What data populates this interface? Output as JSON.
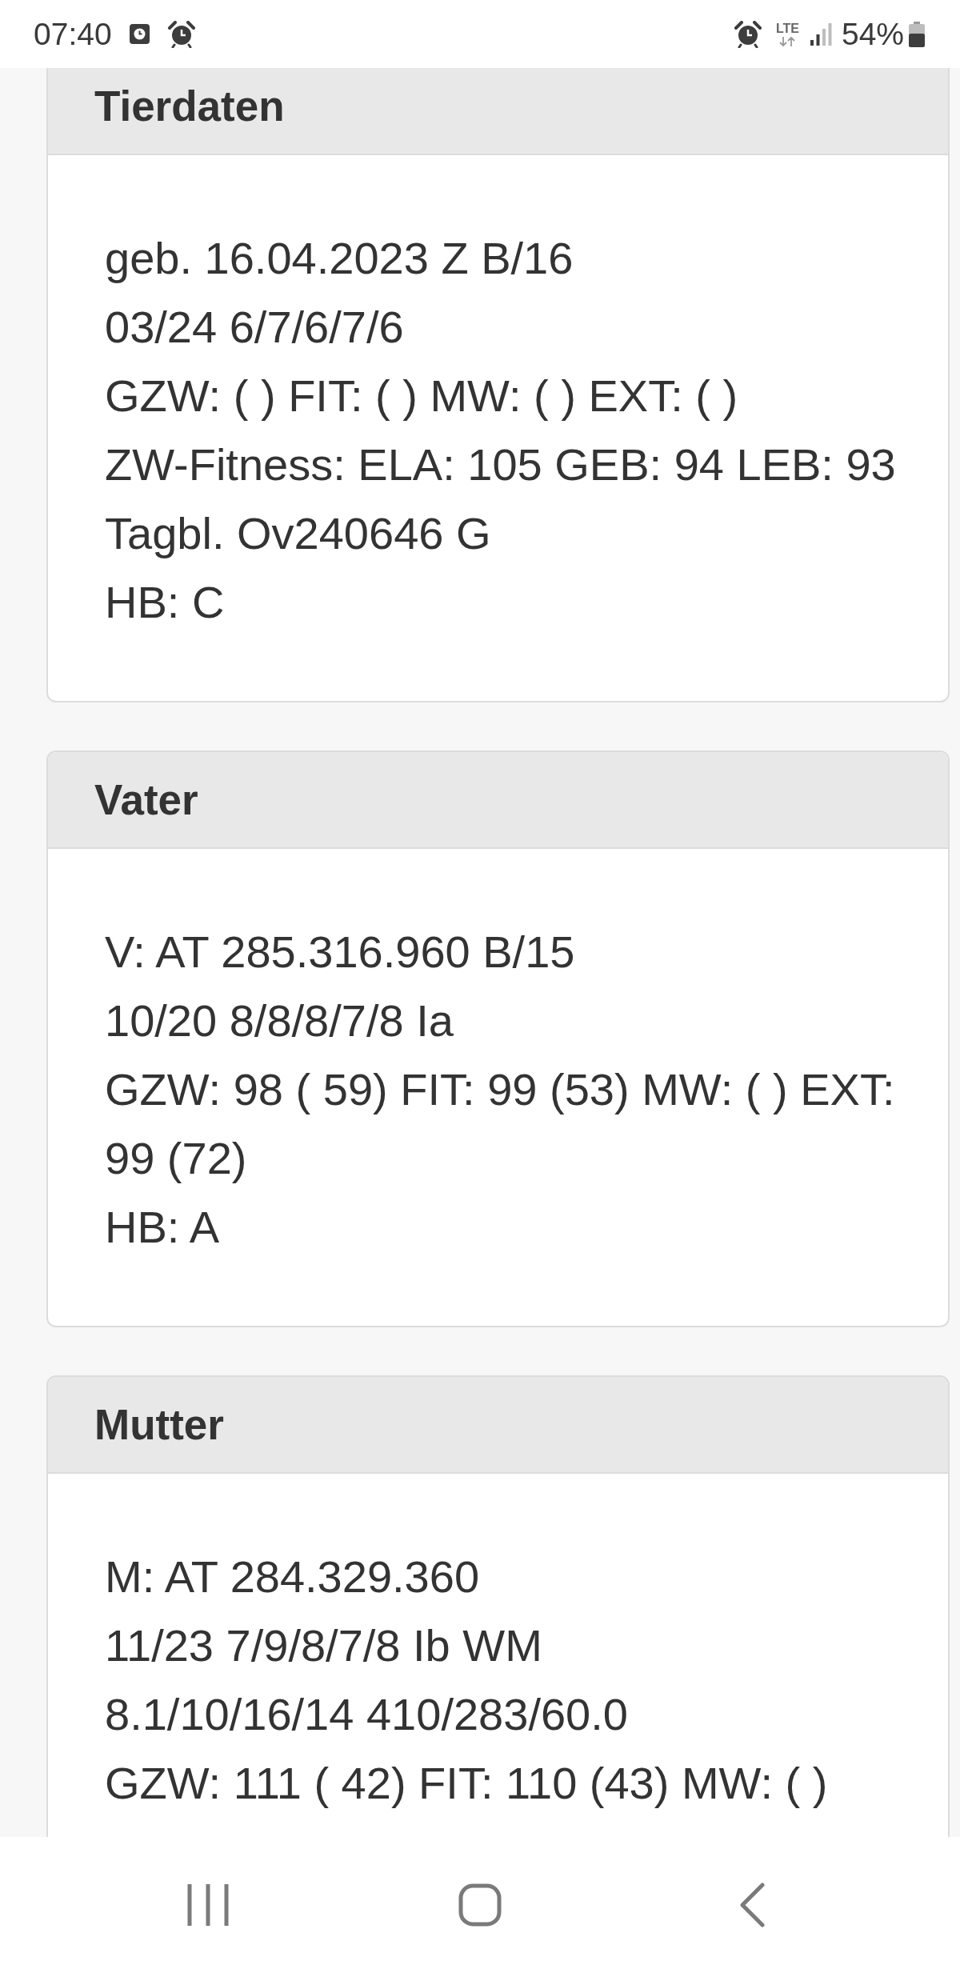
{
  "status_bar": {
    "time": "07:40",
    "network": "LTE",
    "battery": "54%"
  },
  "cards": [
    {
      "title": "Tierdaten",
      "lines": [
        "geb. 16.04.2023 Z B/16",
        "03/24 6/7/6/7/6",
        "GZW: ( ) FIT: ( ) MW: ( ) EXT: ( )",
        "ZW-Fitness: ELA: 105 GEB: 94 LEB: 93",
        "Tagbl. Ov240646 G",
        "HB: C"
      ]
    },
    {
      "title": "Vater",
      "lines": [
        "V: AT 285.316.960 B/15",
        "10/20 8/8/8/7/8 Ia",
        "GZW: 98 ( 59) FIT: 99 (53) MW: ( ) EXT: 99 (72)",
        "HB: A"
      ]
    },
    {
      "title": "Mutter",
      "lines": [
        "M: AT 284.329.360",
        "11/23 7/9/8/7/8 Ib WM",
        "8.1/10/16/14 410/283/60.0",
        "GZW: 111 ( 42) FIT: 110 (43) MW: ( )"
      ]
    }
  ]
}
